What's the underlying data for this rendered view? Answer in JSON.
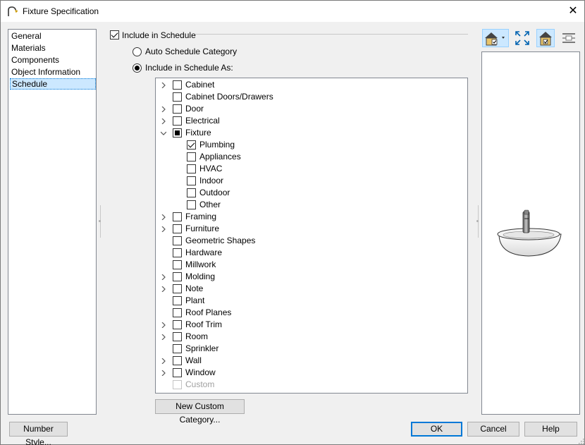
{
  "window": {
    "title": "Fixture Specification",
    "close_glyph": "✕"
  },
  "nav": {
    "items": [
      {
        "label": "General"
      },
      {
        "label": "Materials"
      },
      {
        "label": "Components"
      },
      {
        "label": "Object Information"
      },
      {
        "label": "Schedule",
        "selected": true
      }
    ]
  },
  "schedule": {
    "include_label": "Include in Schedule",
    "include_checked": true,
    "auto_label": "Auto Schedule Category",
    "include_as_label": "Include in Schedule As:",
    "selected_option": "include_as"
  },
  "tree": {
    "items": [
      {
        "label": "Cabinet",
        "expander": "collapsed",
        "state": "unchecked",
        "level": 0
      },
      {
        "label": "Cabinet Doors/Drawers",
        "expander": "none",
        "state": "unchecked",
        "level": 0
      },
      {
        "label": "Door",
        "expander": "collapsed",
        "state": "unchecked",
        "level": 0
      },
      {
        "label": "Electrical",
        "expander": "collapsed",
        "state": "unchecked",
        "level": 0
      },
      {
        "label": "Fixture",
        "expander": "expanded",
        "state": "indeterminate",
        "level": 0
      },
      {
        "label": "Plumbing",
        "expander": "none",
        "state": "checked",
        "level": 1
      },
      {
        "label": "Appliances",
        "expander": "none",
        "state": "unchecked",
        "level": 1
      },
      {
        "label": "HVAC",
        "expander": "none",
        "state": "unchecked",
        "level": 1
      },
      {
        "label": "Indoor",
        "expander": "none",
        "state": "unchecked",
        "level": 1
      },
      {
        "label": "Outdoor",
        "expander": "none",
        "state": "unchecked",
        "level": 1
      },
      {
        "label": "Other",
        "expander": "none",
        "state": "unchecked",
        "level": 1
      },
      {
        "label": "Framing",
        "expander": "collapsed",
        "state": "unchecked",
        "level": 0
      },
      {
        "label": "Furniture",
        "expander": "collapsed",
        "state": "unchecked",
        "level": 0
      },
      {
        "label": "Geometric Shapes",
        "expander": "none",
        "state": "unchecked",
        "level": 0
      },
      {
        "label": "Hardware",
        "expander": "none",
        "state": "unchecked",
        "level": 0
      },
      {
        "label": "Millwork",
        "expander": "none",
        "state": "unchecked",
        "level": 0
      },
      {
        "label": "Molding",
        "expander": "collapsed",
        "state": "unchecked",
        "level": 0
      },
      {
        "label": "Note",
        "expander": "collapsed",
        "state": "unchecked",
        "level": 0
      },
      {
        "label": "Plant",
        "expander": "none",
        "state": "unchecked",
        "level": 0
      },
      {
        "label": "Roof Planes",
        "expander": "none",
        "state": "unchecked",
        "level": 0
      },
      {
        "label": "Roof Trim",
        "expander": "collapsed",
        "state": "unchecked",
        "level": 0
      },
      {
        "label": "Room",
        "expander": "collapsed",
        "state": "unchecked",
        "level": 0
      },
      {
        "label": "Sprinkler",
        "expander": "none",
        "state": "unchecked",
        "level": 0
      },
      {
        "label": "Wall",
        "expander": "collapsed",
        "state": "unchecked",
        "level": 0
      },
      {
        "label": "Window",
        "expander": "collapsed",
        "state": "unchecked",
        "level": 0
      },
      {
        "label": "Custom",
        "expander": "none",
        "state": "disabled",
        "level": 0
      }
    ]
  },
  "buttons": {
    "new_custom": "New Custom Category...",
    "number_style": "Number Style...",
    "ok": "OK",
    "cancel": "Cancel",
    "help": "Help"
  },
  "toolbar": {
    "icons": [
      "camera-view-icon",
      "fill-window-icon",
      "preview-mode-icon",
      "options-icon"
    ]
  },
  "colors": {
    "selection": "#cce8ff",
    "focus_border": "#0078d7",
    "disabled_text": "#a0a0a0"
  }
}
